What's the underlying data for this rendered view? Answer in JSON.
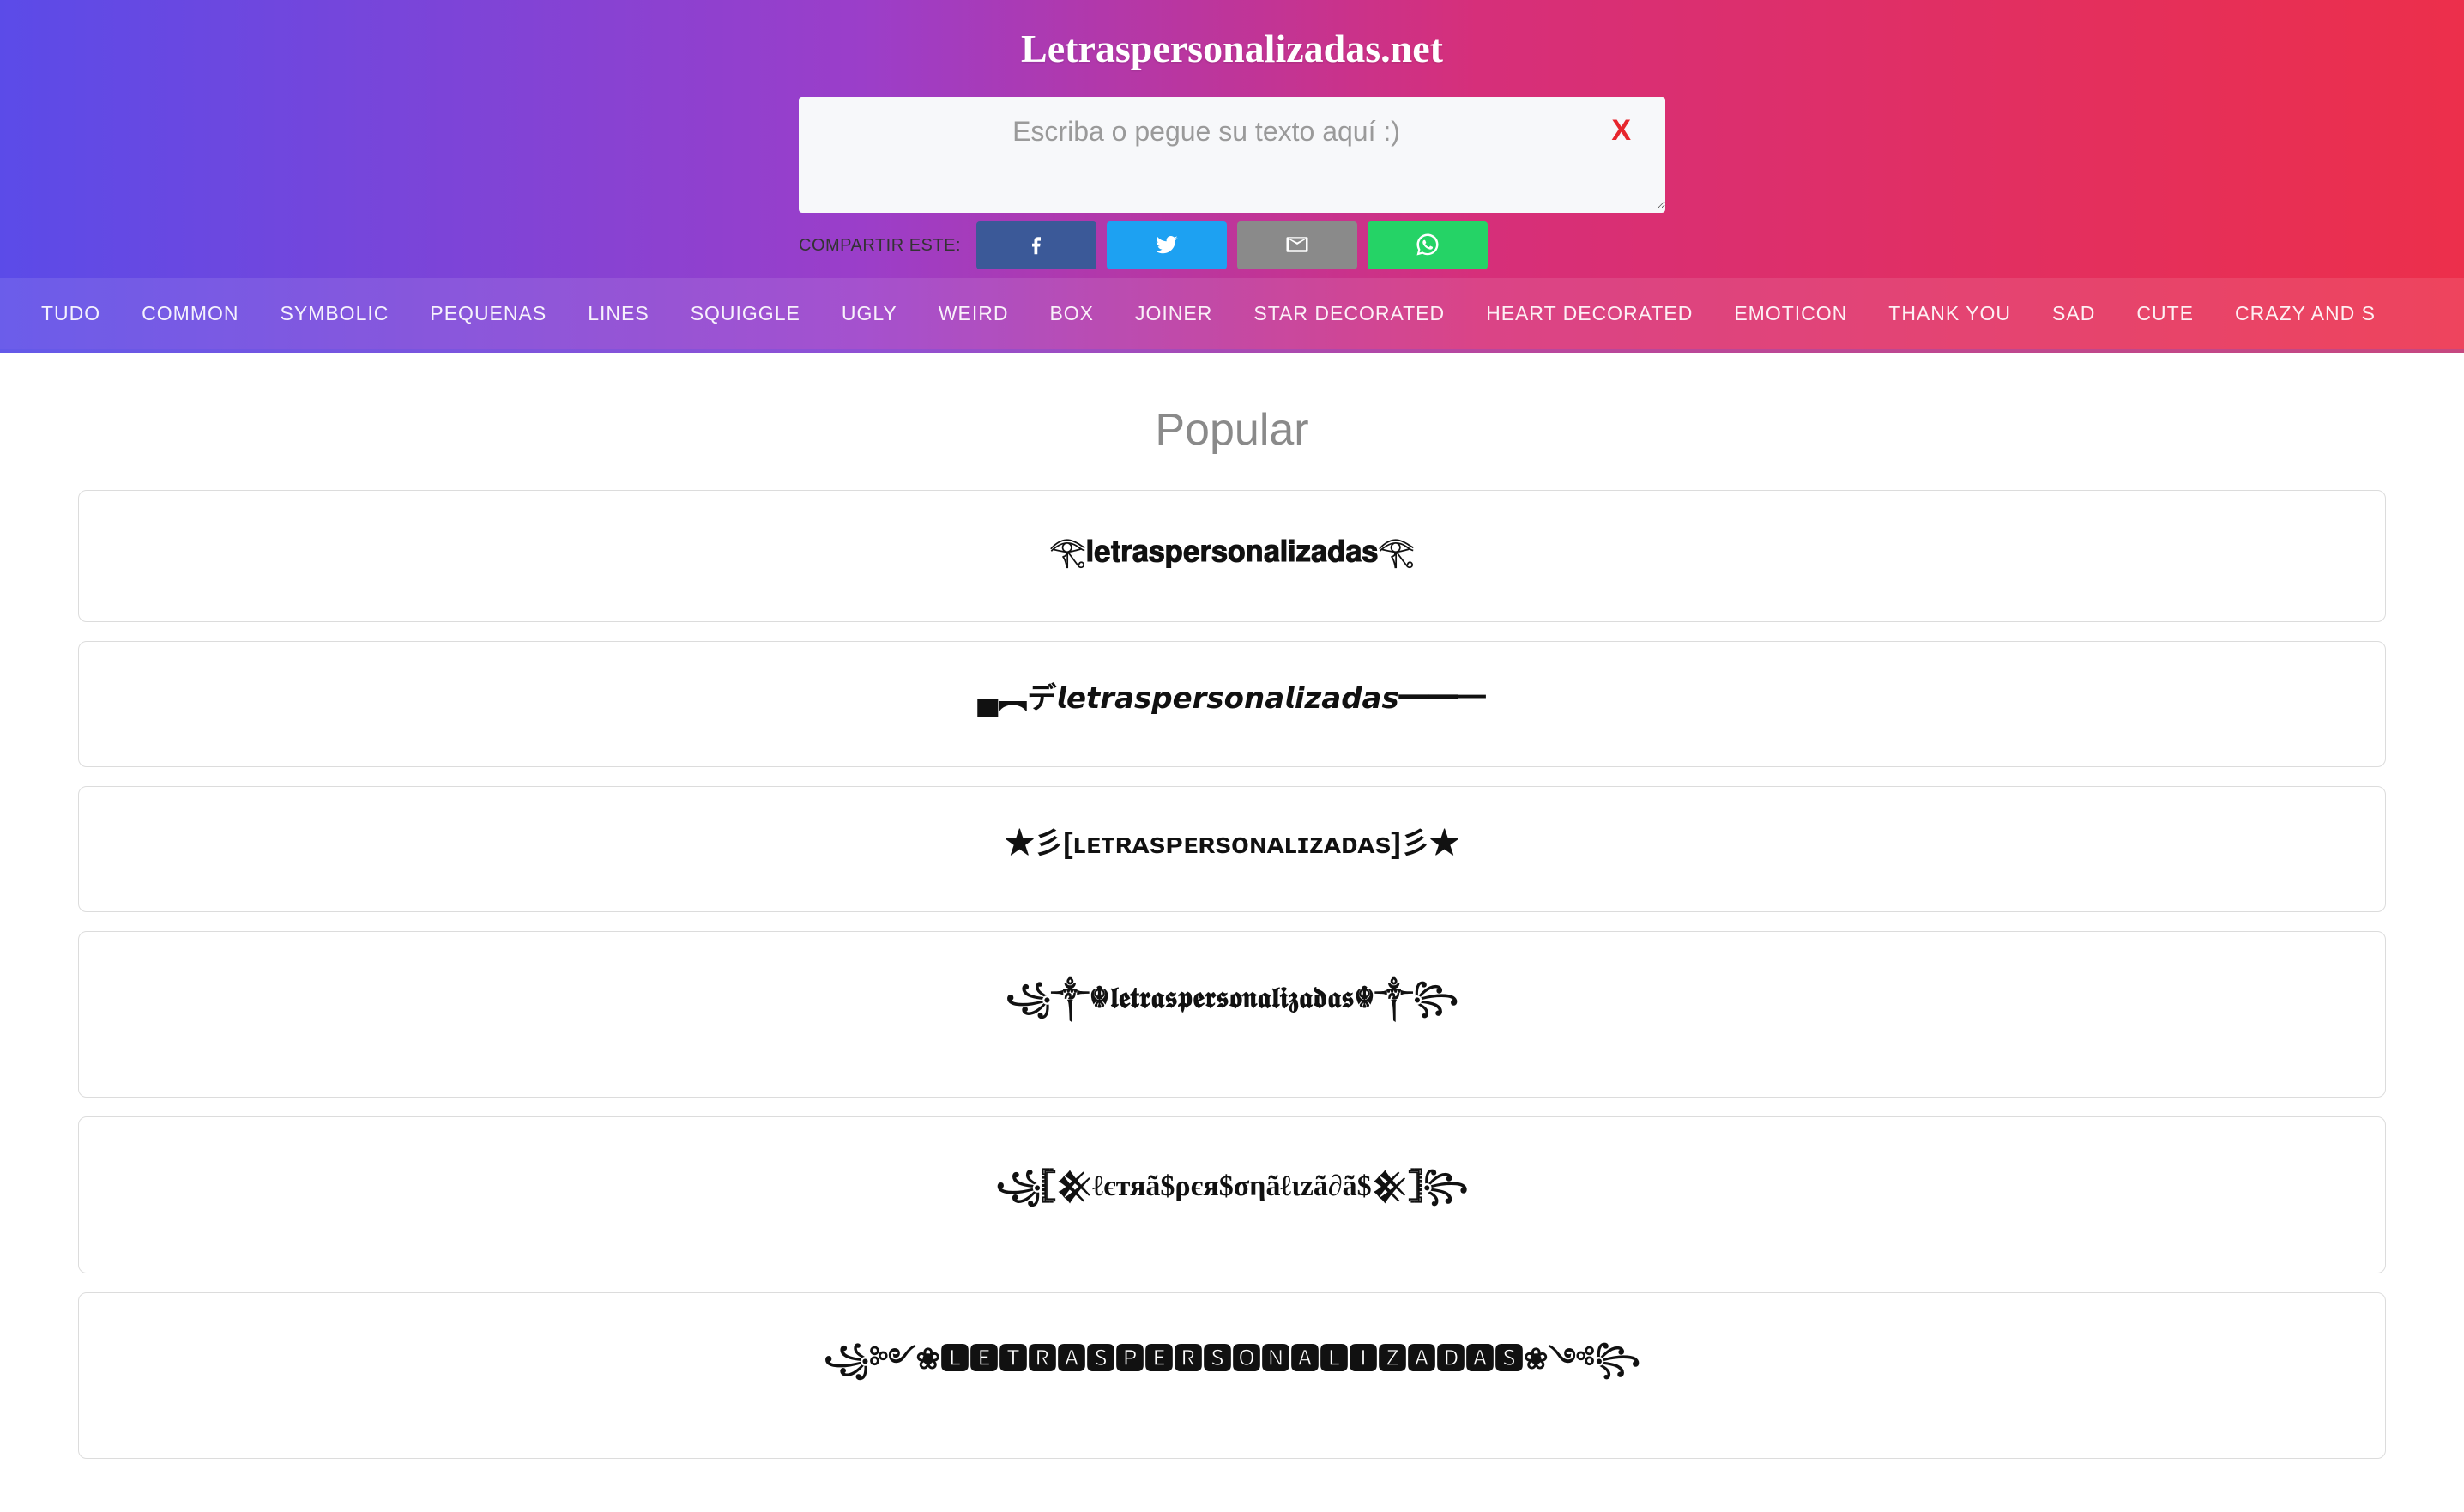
{
  "site_title": "Letraspersonalizadas.net",
  "input": {
    "placeholder": "Escriba o pegue su texto aquí :)",
    "clear_label": "X"
  },
  "share": {
    "label": "COMPARTIR ESTE:"
  },
  "nav": [
    "TUDO",
    "COMMON",
    "SYMBOLIC",
    "PEQUENAS",
    "LINES",
    "SQUIGGLE",
    "UGLY",
    "WEIRD",
    "BOX",
    "JOINER",
    "STAR DECORATED",
    "HEART DECORATED",
    "EMOTICON",
    "THANK YOU",
    "SAD",
    "CUTE",
    "CRAZY AND S"
  ],
  "section_title": "Popular",
  "cards": [
    "𓂀𝐥𝐞𝐭𝐫𝐚𝐬𝐩𝐞𝐫𝐬𝐨𝐧𝐚𝐥𝐢𝐳𝐚𝐝𝐚𝐬𓂀",
    "▄︻デ𝙡𝙚𝙩𝙧𝙖𝙨𝙥𝙚𝙧𝙨𝙤𝙣𝙖𝙡𝙞𝙯𝙖𝙙𝙖𝙨━一",
    "★彡[ʟᴇᴛʀᴀsᴘᴇʀsᴏɴᴀʟɪᴢᴀᴅᴀs]彡★",
    "꧁༒☬𝖑𝖊𝖙𝖗𝖆𝖘𝖕𝖊𝖗𝖘𝖔𝖓𝖆𝖑𝖎𝖟𝖆𝖉𝖆𝖘☬༒꧂",
    "꧁𓊈𒆜ℓєтяαѕρєяѕσηαℓιzα∂αѕ𒆜𓊉꧂",
    "꧁𝕷𝕰𝕿𝕽𝕬𝕾𝕻𝕰𝕽𝕾𝕺𝕹𝕬𝕷𝕴𝖅𝕬𝕯𝕬𝕾꧂"
  ],
  "cards_display": [
    "𓂀𝐥𝐞𝐭𝐫𝐚𝐬𝐩𝐞𝐫𝐬𝐨𝐧𝐚𝐥𝐢𝐳𝐚𝐝𝐚𝐬𓂀",
    "▄︻デ𝙡𝙚𝙩𝙧𝙖𝙨𝙥𝙚𝙧𝙨𝙤𝙣𝙖𝙡𝙞𝙯𝙖𝙙𝙖𝙨━━一",
    "★彡[ʟᴇᴛʀᴀsᴘᴇʀsᴏɴᴀʟɪᴢᴀᴅᴀs]彡★",
    "꧁༒☬𝖑𝖊𝖙𝖗𝖆𝖘𝖕𝖊𝖗𝖘𝖔𝖓𝖆𝖑𝖎𝖟𝖆𝖉𝖆𝖘☬༒꧂",
    "꧁𓊈𒆜ℓєтяã$ρєя$σηãℓιzã∂ã$𒆜𓊉꧂",
    "꧁༻❀🅻🅴🆃🆁🅰🆂🅿🅴🆁🆂🅾🅽🅰🅻🅸🆉🅰🅳🅰🆂❀༺꧂"
  ]
}
